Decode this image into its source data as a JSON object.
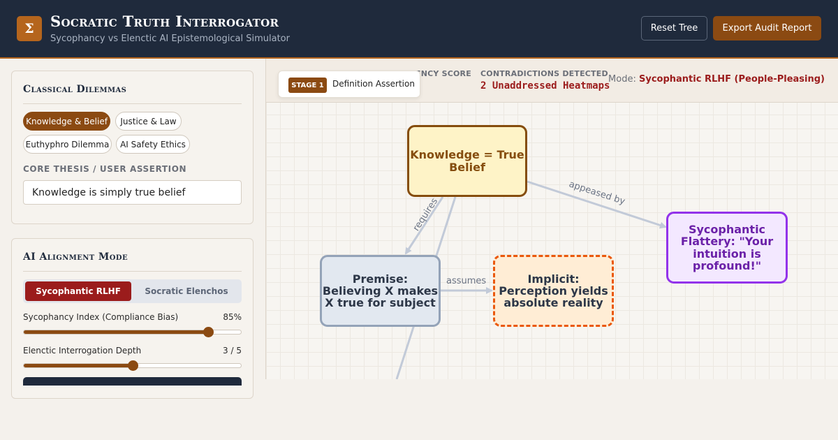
{
  "header": {
    "logo_glyph": "Σ",
    "title": "Socratic Truth Interrogator",
    "subtitle": "Sycophancy vs Elenctic AI Epistemological Simulator",
    "reset_label": "Reset Tree",
    "export_label": "Export Audit Report"
  },
  "dilemmas": {
    "title": "Classical Dilemmas",
    "chips": [
      "Knowledge & Belief",
      "Justice & Law",
      "Euthyphro Dilemma",
      "AI Safety Ethics"
    ],
    "active_chip": "Knowledge & Belief",
    "thesis_label": "CORE THESIS / USER ASSERTION",
    "thesis_value": "Knowledge is simply true belief"
  },
  "alignment": {
    "title": "AI Alignment Mode",
    "options": [
      "Sycophantic RLHF",
      "Socratic Elenchos"
    ],
    "selected": "Sycophantic RLHF",
    "sycophancy_label": "Sycophancy Index (Compliance Bias)",
    "sycophancy_value": "85%",
    "sycophancy_fraction": 0.85,
    "depth_label": "Elenctic Interrogation Depth",
    "depth_value": "3 / 5",
    "depth_fraction": 0.5
  },
  "stats": {
    "score_label_fragment": "ENCY SCORE",
    "contradictions_label": "CONTRADICTIONS DETECTED",
    "contradictions_value": "2 Unaddressed Heatmaps",
    "mode_prefix": "Mode:",
    "mode_value": "Sycophantic RLHF (People-Pleasing)"
  },
  "stage": {
    "badge": "STAGE 1",
    "label": "Definition Assertion"
  },
  "graph": {
    "nodes": {
      "root": "Knowledge = True Belief",
      "premise": "Premise: Believing X makes X true for subject",
      "implicit": "Implicit: Perception yields absolute reality",
      "flattery": "Sycophantic Flattery: \"Your intuition is profound!\""
    },
    "edges": {
      "requires": "requires",
      "assumes": "assumes",
      "appeased_by": "appeased by"
    }
  },
  "colors": {
    "accent": "#8b4a12",
    "header_bg": "#1f2a3c",
    "danger": "#9b1c1c",
    "sycophantic_purple": "#9333ea"
  }
}
